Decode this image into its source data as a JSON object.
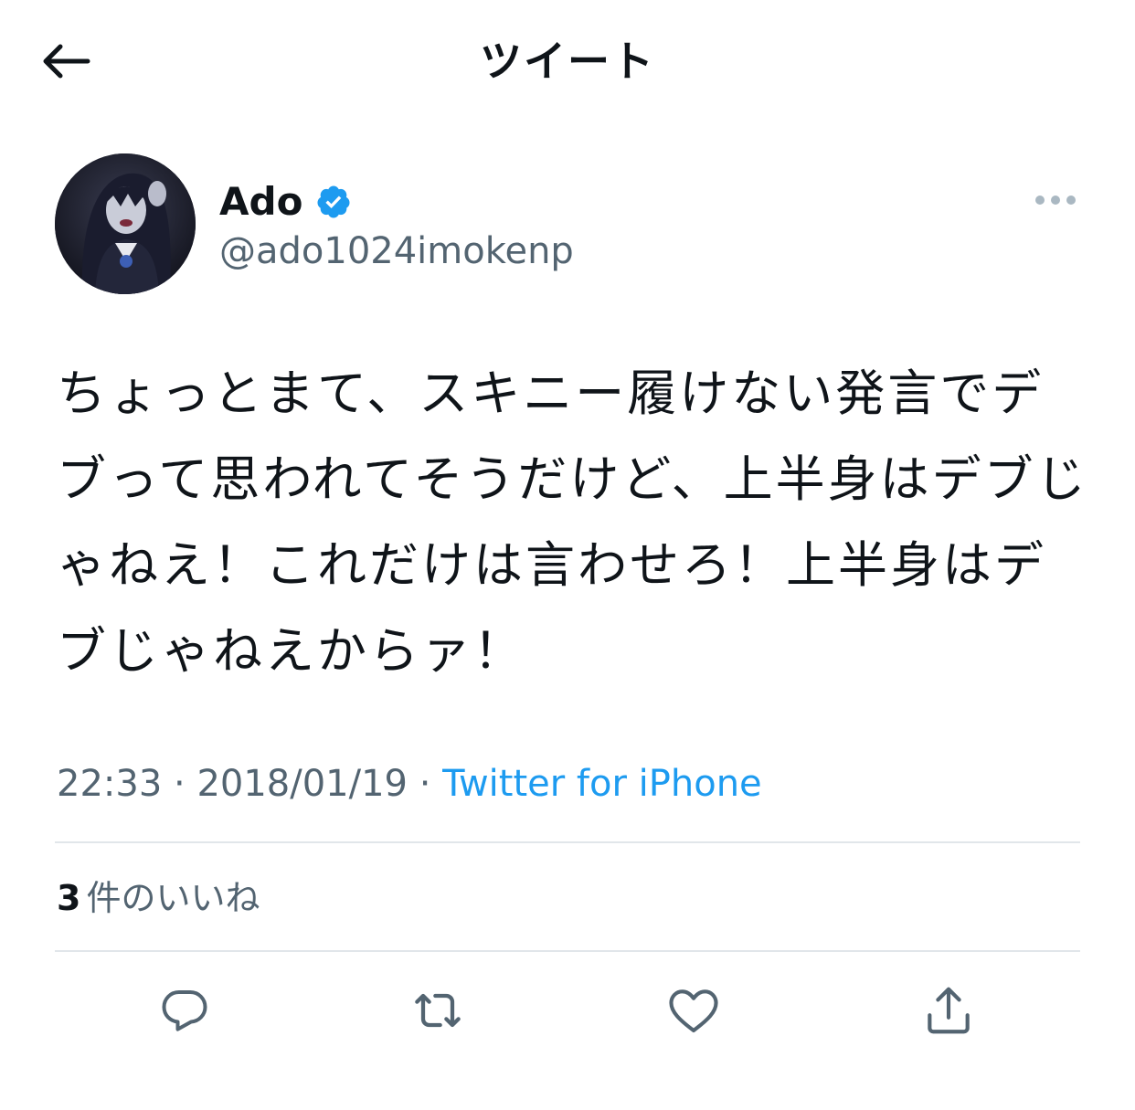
{
  "header": {
    "title": "ツイート",
    "back_icon": "arrow-left-icon"
  },
  "author": {
    "display_name": "Ado",
    "handle": "@ado1024imokenp",
    "verified": true,
    "verified_color": "#1d9bf0",
    "avatar_icon": "avatar-image"
  },
  "tweet": {
    "text": "ちょっとまて、スキニー履けない発言でデブって思われてそうだけど、上半身はデブじゃねえ！これだけは言わせろ！上半身はデブじゃねえからァ！"
  },
  "meta": {
    "time": "22:33",
    "date": "2018/01/19",
    "separator": "·",
    "source": "Twitter for iPhone"
  },
  "stats": {
    "likes_count": "3",
    "likes_label": "件のいいね"
  },
  "actions": [
    {
      "icon": "reply-icon"
    },
    {
      "icon": "retweet-icon"
    },
    {
      "icon": "like-icon"
    },
    {
      "icon": "share-icon"
    }
  ],
  "colors": {
    "text_primary": "#0f1419",
    "text_secondary": "#536471",
    "link": "#1d9bf0",
    "divider": "#e1e6ea"
  }
}
